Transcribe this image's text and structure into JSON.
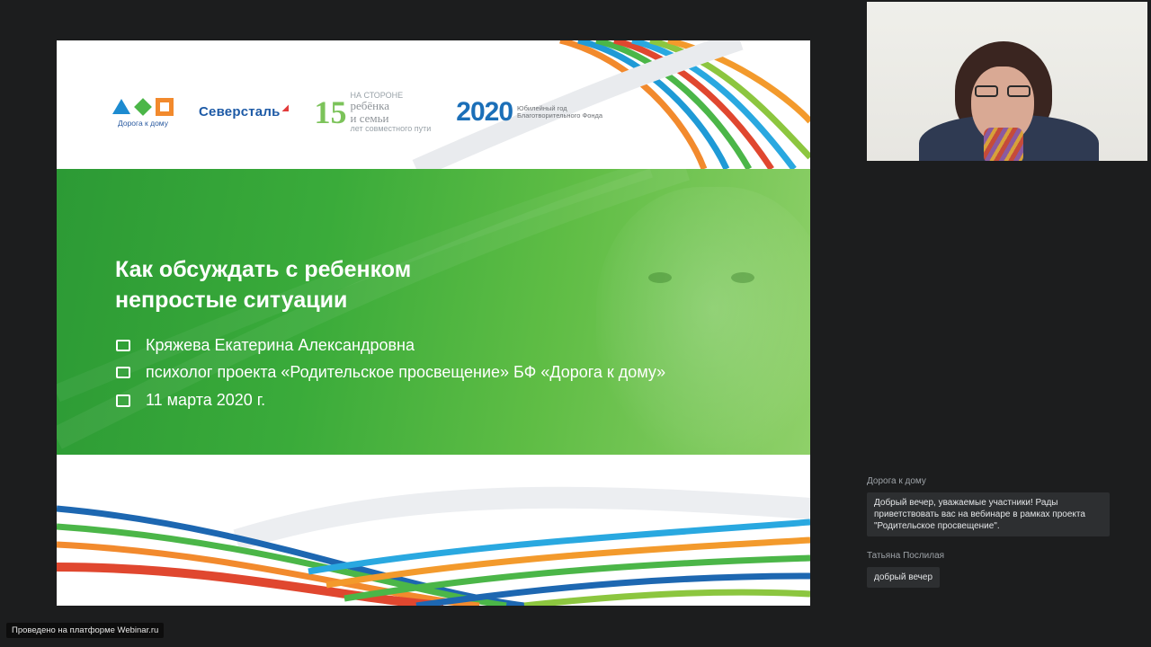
{
  "slide": {
    "logos": {
      "doroga_label": "Дорога к дому",
      "severstal": "Северсталь",
      "na_storone_1": "НА СТОРОНЕ",
      "na_storone_2": "ребёнка",
      "na_storone_3": "и семьи",
      "na_storone_4": "лет совместного пути",
      "anniversary_num": "15",
      "year_2020": "2020",
      "jubilee_1": "Юбилейный год",
      "jubilee_2": "Благотворительного Фонда"
    },
    "title_line1": "Как обсуждать с ребенком",
    "title_line2": "непростые ситуации",
    "speaker": "Кряжева Екатерина Александровна",
    "role": "психолог проекта «Родительское просвещение» БФ «Дорога к дому»",
    "date": "11 марта 2020 г."
  },
  "chat": {
    "messages": [
      {
        "author": "Дорога к дому",
        "text": "Добрый вечер, уважаемые участники! Рады приветствовать вас на вебинаре в рамках проекта \"Родительское просвещение\"."
      },
      {
        "author": "Татьяна Послилая",
        "text": "добрый вечер"
      }
    ]
  },
  "footer": {
    "platform": "Проведено на платформе Webinar.ru"
  },
  "colors": {
    "background": "#1c1d1e",
    "slide_green": "#3aab3a",
    "chat_bubble": "#2d2f31"
  },
  "icons": [
    "id-card-icon",
    "briefcase-icon",
    "calendar-icon"
  ]
}
